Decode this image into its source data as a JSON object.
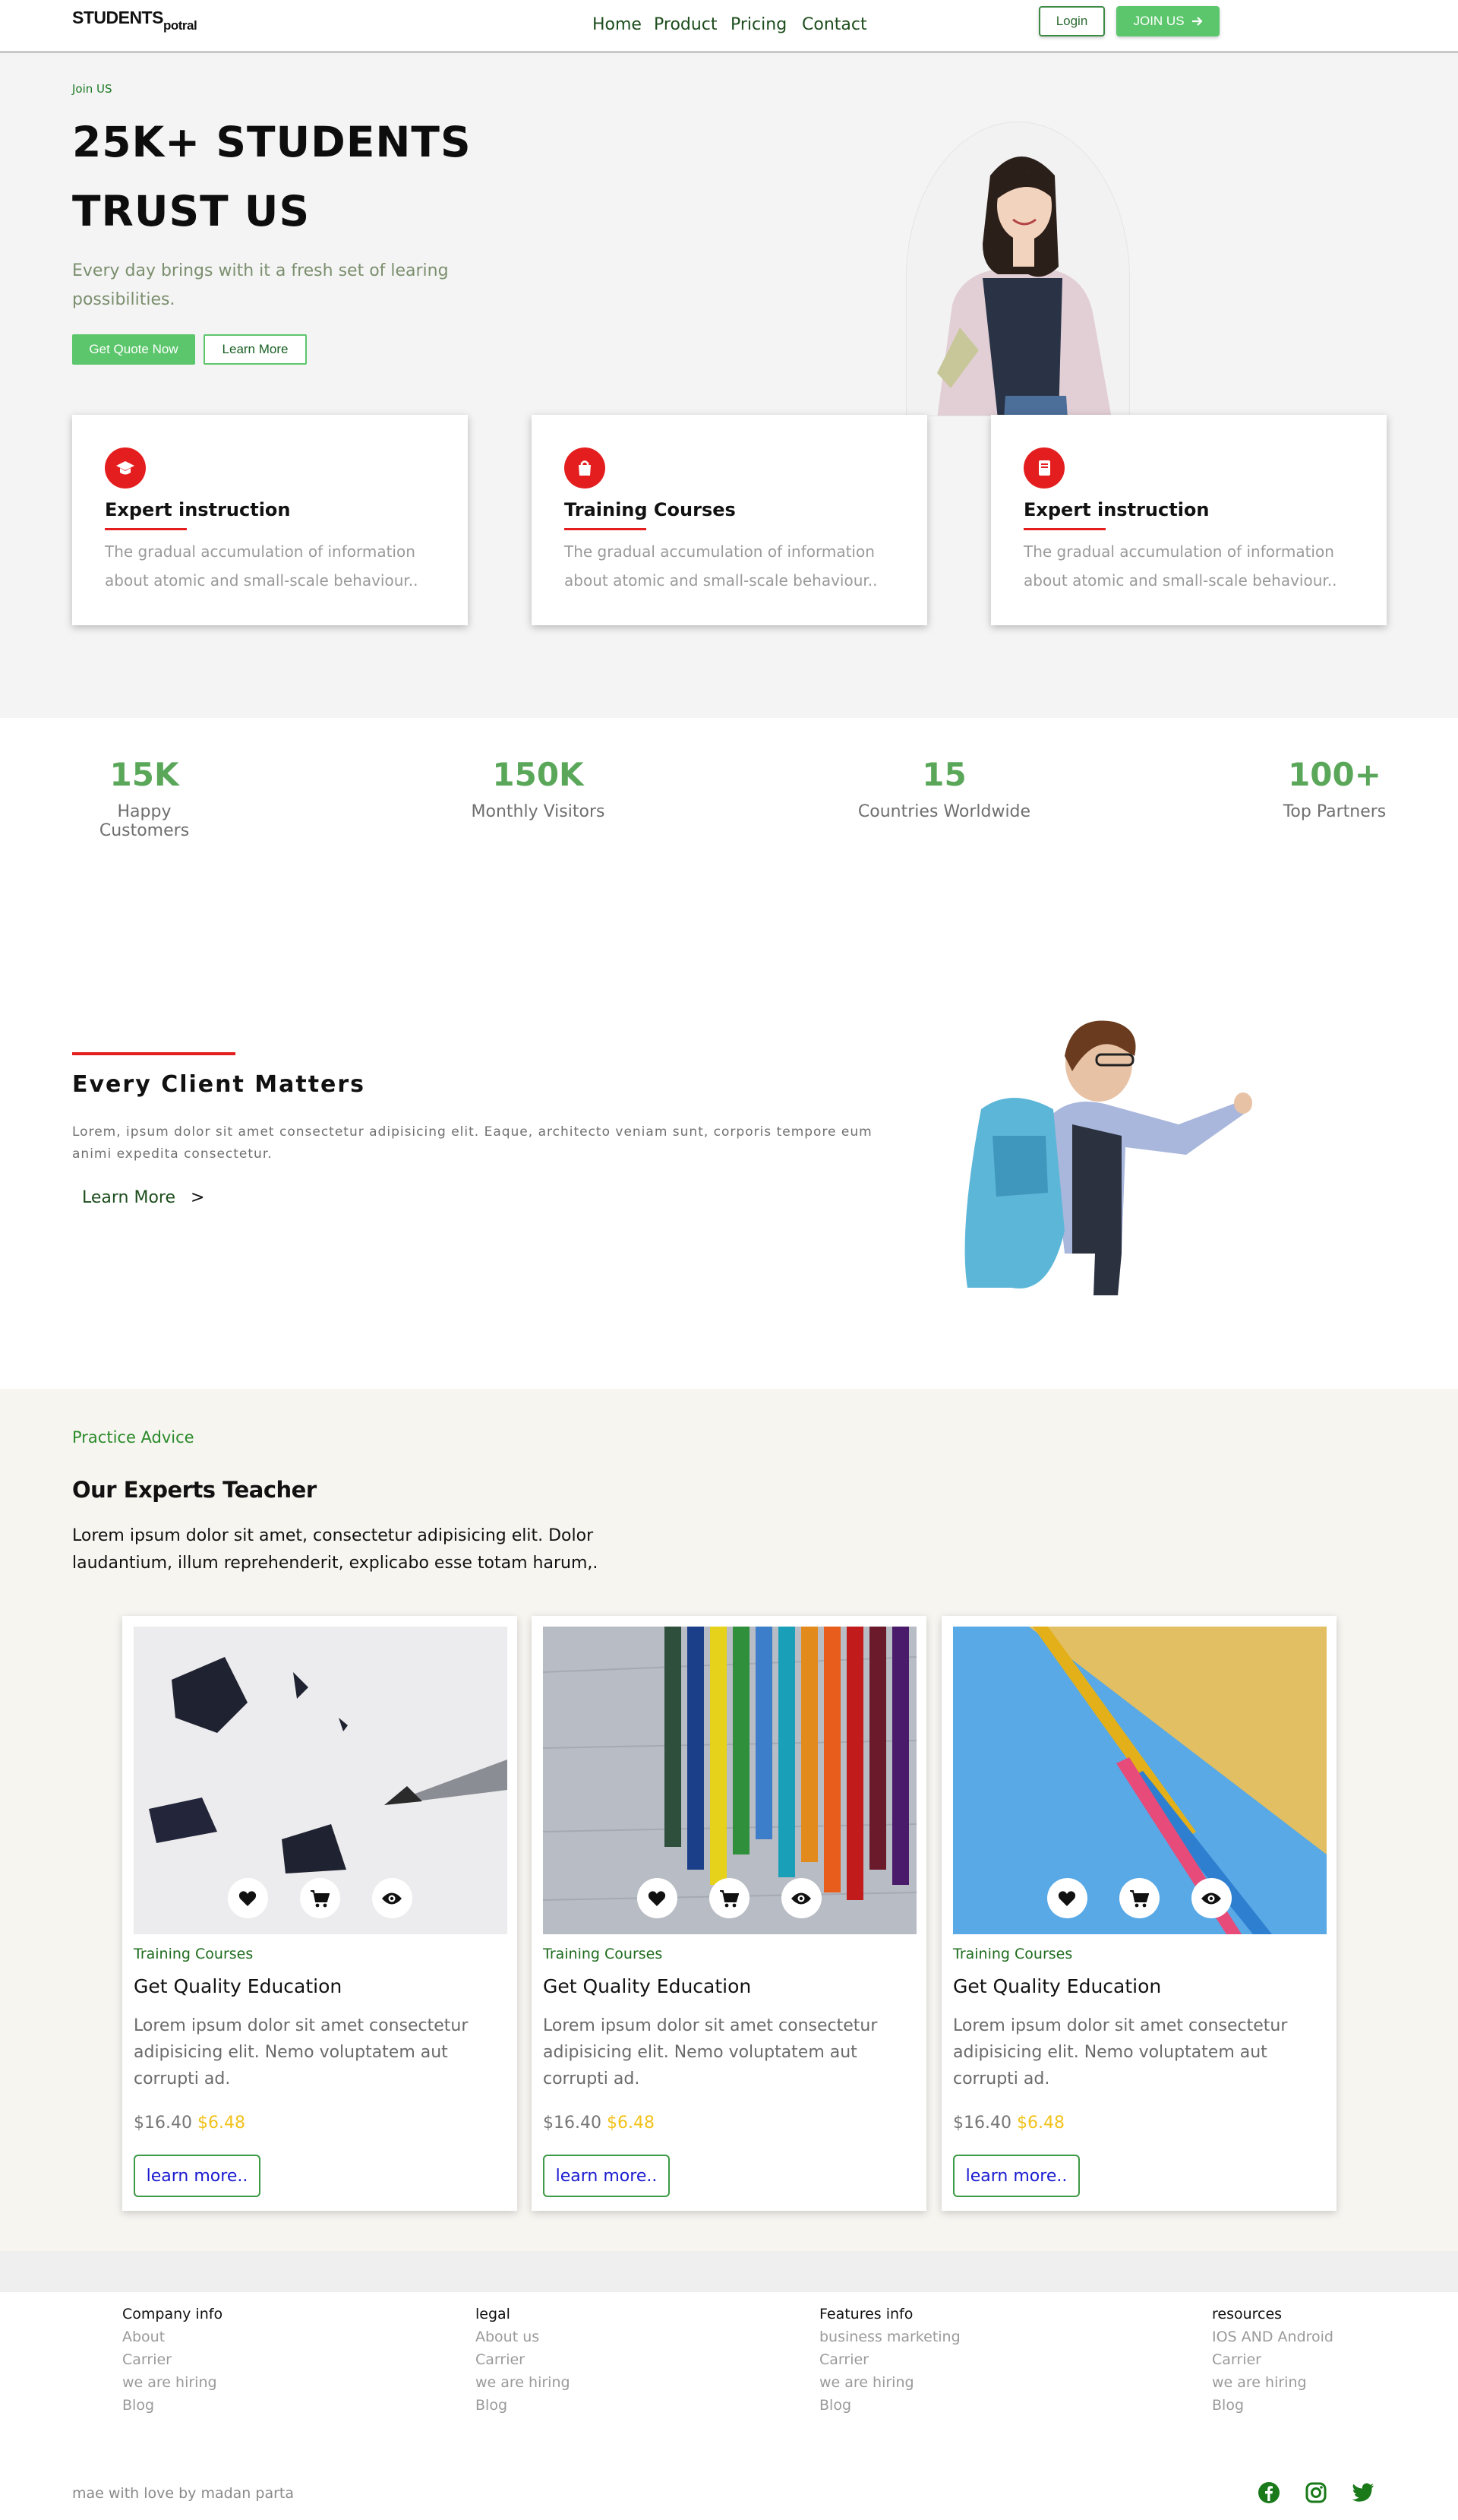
{
  "header": {
    "brand_main": "STUDENTS",
    "brand_sub": "potral",
    "nav": [
      "Home",
      "Product",
      "Pricing",
      "Contact"
    ],
    "login": "Login",
    "join": "JOIN US"
  },
  "hero": {
    "eyebrow": "Join US",
    "title_line1": "25K+ STUDENTS",
    "title_line2": "TRUST US",
    "paragraph": "Every day brings with it a fresh set of learing possibilities.",
    "cta_primary": "Get Quote Now",
    "cta_secondary": "Learn More"
  },
  "features": [
    {
      "icon": "graduation-cap-icon",
      "title": "Expert instruction",
      "desc": "The gradual accumulation of information about atomic and small-scale behaviour.."
    },
    {
      "icon": "shopping-bag-icon",
      "title": "Training Courses",
      "desc": "The gradual accumulation of information about atomic and small-scale behaviour.."
    },
    {
      "icon": "book-icon",
      "title": "Expert instruction",
      "desc": "The gradual accumulation of information about atomic and small-scale behaviour.."
    }
  ],
  "stats": [
    {
      "value": "15K",
      "label": "Happy Customers"
    },
    {
      "value": "150K",
      "label": "Monthly Visitors"
    },
    {
      "value": "15",
      "label": "Countries Worldwide"
    },
    {
      "value": "100+",
      "label": "Top Partners"
    }
  ],
  "client": {
    "title": "Every Client Matters",
    "paragraph": "Lorem, ipsum dolor sit amet consectetur adipisicing elit. Eaque, architecto veniam sunt, corporis tempore eum animi expedita consectetur.",
    "link": "Learn More",
    "arrow": ">"
  },
  "experts": {
    "eyebrow": "Practice Advice",
    "title": "Our Experts Teacher",
    "paragraph": "Lorem ipsum dolor sit amet, consectetur adipisicing elit. Dolor laudantium, illum reprehenderit, explicabo esse totam harum,."
  },
  "products": [
    {
      "image": "pencil-shavings-photo",
      "category": "Training Courses",
      "title": "Get Quality Education",
      "text": "Lorem ipsum dolor sit amet consectetur adipisicing elit. Nemo voluptatem aut corrupti ad.",
      "price": "$16.40",
      "sale": "$6.48",
      "button": "learn more.."
    },
    {
      "image": "colored-pencils-photo",
      "category": "Training Courses",
      "title": "Get Quality Education",
      "text": "Lorem ipsum dolor sit amet consectetur adipisicing elit. Nemo voluptatem aut corrupti ad.",
      "price": "$16.40",
      "sale": "$6.48",
      "button": "learn more.."
    },
    {
      "image": "pencils-on-blue-photo",
      "category": "Training Courses",
      "title": "Get Quality Education",
      "text": "Lorem ipsum dolor sit amet consectetur adipisicing elit. Nemo voluptatem aut corrupti ad.",
      "price": "$16.40",
      "sale": "$6.48",
      "button": "learn more.."
    }
  ],
  "footer": {
    "columns": [
      {
        "heading": "Company info",
        "links": [
          "About",
          "Carrier",
          "we are hiring",
          "Blog"
        ]
      },
      {
        "heading": "legal",
        "links": [
          "About us",
          "Carrier",
          "we are hiring",
          "Blog"
        ]
      },
      {
        "heading": "Features info",
        "links": [
          "business marketing",
          "Carrier",
          "we are hiring",
          "Blog"
        ]
      },
      {
        "heading": "resources",
        "links": [
          "IOS AND Android",
          "Carrier",
          "we are hiring",
          "Blog"
        ]
      }
    ],
    "credit": "mae with love by madan parta",
    "social": [
      "facebook-icon",
      "instagram-icon",
      "twitter-icon"
    ]
  },
  "colors": {
    "accent_green": "#5cc66c",
    "accent_red": "#e41e1e",
    "price_sale": "#f2c21a",
    "link_blue": "#1a1ad0"
  }
}
